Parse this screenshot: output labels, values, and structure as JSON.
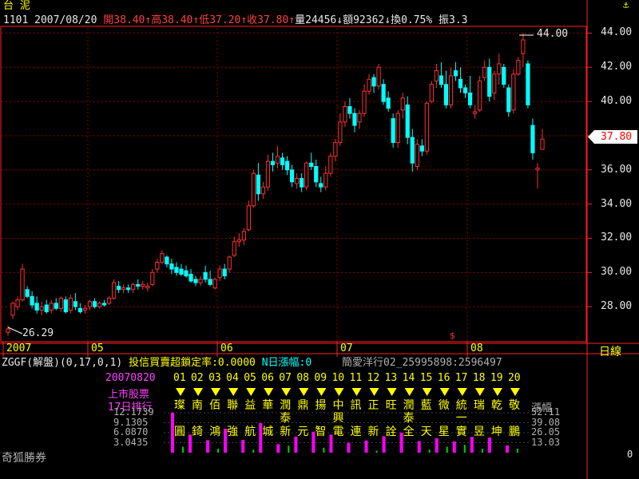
{
  "header": {
    "stock_name": "台 泥",
    "stock_code": "1101",
    "date": "2007/08/20",
    "open": "開38.40↑",
    "high": "高38.40↑",
    "low": "低37.20↑",
    "close": "收37.80↑",
    "volume": "量24456↓",
    "amount": "額92362↓",
    "turnover": "換0.75%",
    "amplitude": "振3.3"
  },
  "chart_data": {
    "type": "candlestick",
    "price_axis": {
      "ticks": [
        "44.00",
        "42.00",
        "40.00",
        "38.00",
        "36.00",
        "34.00",
        "32.00",
        "30.00",
        "28.00"
      ],
      "ylim": [
        26.0,
        44.3
      ],
      "grid": true
    },
    "x_axis": {
      "labels": [
        "2007",
        "05",
        "06",
        "07",
        "08"
      ],
      "right_label": "日線"
    },
    "annotations": {
      "high_marker": "44.00",
      "low_marker": "26.29",
      "last_price": "37.80"
    },
    "candles": [
      {
        "o": 26.5,
        "h": 26.9,
        "l": 26.3,
        "c": 26.7
      },
      {
        "o": 27.5,
        "h": 28.3,
        "l": 27.3,
        "c": 28.2
      },
      {
        "o": 28.0,
        "h": 28.6,
        "l": 27.8,
        "c": 28.4
      },
      {
        "o": 28.4,
        "h": 30.5,
        "l": 28.3,
        "c": 30.2
      },
      {
        "o": 29.0,
        "h": 29.2,
        "l": 28.5,
        "c": 28.6
      },
      {
        "o": 28.6,
        "h": 28.9,
        "l": 27.9,
        "c": 28.1
      },
      {
        "o": 28.2,
        "h": 28.6,
        "l": 27.6,
        "c": 27.8
      },
      {
        "o": 27.8,
        "h": 28.3,
        "l": 27.5,
        "c": 28.0
      },
      {
        "o": 28.1,
        "h": 28.4,
        "l": 27.6,
        "c": 27.7
      },
      {
        "o": 27.8,
        "h": 28.4,
        "l": 27.6,
        "c": 28.2
      },
      {
        "o": 28.2,
        "h": 28.5,
        "l": 27.8,
        "c": 27.9
      },
      {
        "o": 27.9,
        "h": 28.6,
        "l": 27.7,
        "c": 28.5
      },
      {
        "o": 28.4,
        "h": 28.6,
        "l": 27.6,
        "c": 27.7
      },
      {
        "o": 27.8,
        "h": 28.7,
        "l": 27.6,
        "c": 28.5
      },
      {
        "o": 28.3,
        "h": 28.8,
        "l": 27.8,
        "c": 28.0
      },
      {
        "o": 27.9,
        "h": 28.2,
        "l": 27.6,
        "c": 27.7
      },
      {
        "o": 27.8,
        "h": 28.1,
        "l": 27.6,
        "c": 27.9
      },
      {
        "o": 28.0,
        "h": 28.4,
        "l": 27.8,
        "c": 28.3
      },
      {
        "o": 28.3,
        "h": 28.5,
        "l": 27.9,
        "c": 28.0
      },
      {
        "o": 28.0,
        "h": 28.3,
        "l": 27.9,
        "c": 28.2
      },
      {
        "o": 28.2,
        "h": 28.4,
        "l": 28.0,
        "c": 28.1
      },
      {
        "o": 28.2,
        "h": 28.6,
        "l": 28.1,
        "c": 28.5
      },
      {
        "o": 28.5,
        "h": 29.6,
        "l": 28.4,
        "c": 29.4
      },
      {
        "o": 29.2,
        "h": 29.5,
        "l": 28.8,
        "c": 29.0
      },
      {
        "o": 29.0,
        "h": 29.3,
        "l": 28.8,
        "c": 29.1
      },
      {
        "o": 29.1,
        "h": 29.3,
        "l": 28.8,
        "c": 29.0
      },
      {
        "o": 29.0,
        "h": 29.4,
        "l": 28.8,
        "c": 29.3
      },
      {
        "o": 29.3,
        "h": 29.6,
        "l": 29.0,
        "c": 29.2
      },
      {
        "o": 29.2,
        "h": 29.5,
        "l": 29.0,
        "c": 29.3
      },
      {
        "o": 29.1,
        "h": 29.4,
        "l": 28.9,
        "c": 29.2
      },
      {
        "o": 29.3,
        "h": 30.2,
        "l": 29.2,
        "c": 30.0
      },
      {
        "o": 30.2,
        "h": 30.8,
        "l": 30.0,
        "c": 30.6
      },
      {
        "o": 30.6,
        "h": 31.3,
        "l": 30.5,
        "c": 31.1
      },
      {
        "o": 30.9,
        "h": 31.0,
        "l": 30.3,
        "c": 30.5
      },
      {
        "o": 30.5,
        "h": 30.8,
        "l": 29.9,
        "c": 30.2
      },
      {
        "o": 30.3,
        "h": 30.6,
        "l": 29.8,
        "c": 30.0
      },
      {
        "o": 30.2,
        "h": 30.5,
        "l": 29.8,
        "c": 29.9
      },
      {
        "o": 30.1,
        "h": 30.4,
        "l": 29.7,
        "c": 29.8
      },
      {
        "o": 29.9,
        "h": 30.2,
        "l": 29.4,
        "c": 29.5
      },
      {
        "o": 29.6,
        "h": 29.8,
        "l": 29.2,
        "c": 29.4
      },
      {
        "o": 29.4,
        "h": 29.8,
        "l": 29.2,
        "c": 29.6
      },
      {
        "o": 30.0,
        "h": 30.4,
        "l": 29.4,
        "c": 29.6
      },
      {
        "o": 29.6,
        "h": 30.1,
        "l": 29.2,
        "c": 29.3
      },
      {
        "o": 29.1,
        "h": 29.7,
        "l": 29.0,
        "c": 29.6
      },
      {
        "o": 29.7,
        "h": 30.4,
        "l": 29.5,
        "c": 30.2
      },
      {
        "o": 30.2,
        "h": 30.5,
        "l": 29.6,
        "c": 29.8
      },
      {
        "o": 30.2,
        "h": 31.0,
        "l": 30.0,
        "c": 30.9
      },
      {
        "o": 31.0,
        "h": 32.1,
        "l": 30.9,
        "c": 31.8
      },
      {
        "o": 31.8,
        "h": 32.3,
        "l": 31.5,
        "c": 31.9
      },
      {
        "o": 31.9,
        "h": 32.6,
        "l": 31.6,
        "c": 32.4
      },
      {
        "o": 32.5,
        "h": 34.2,
        "l": 32.4,
        "c": 33.9
      },
      {
        "o": 33.9,
        "h": 36.0,
        "l": 33.8,
        "c": 35.8
      },
      {
        "o": 35.7,
        "h": 36.4,
        "l": 34.2,
        "c": 34.6
      },
      {
        "o": 34.6,
        "h": 35.3,
        "l": 34.3,
        "c": 35.0
      },
      {
        "o": 35.0,
        "h": 36.9,
        "l": 34.8,
        "c": 36.5
      },
      {
        "o": 36.5,
        "h": 37.0,
        "l": 35.9,
        "c": 36.3
      },
      {
        "o": 36.4,
        "h": 37.4,
        "l": 36.1,
        "c": 36.8
      },
      {
        "o": 36.7,
        "h": 37.0,
        "l": 36.0,
        "c": 36.3
      },
      {
        "o": 36.5,
        "h": 36.8,
        "l": 35.7,
        "c": 36.0
      },
      {
        "o": 36.0,
        "h": 36.3,
        "l": 35.0,
        "c": 35.3
      },
      {
        "o": 35.2,
        "h": 35.8,
        "l": 34.9,
        "c": 35.5
      },
      {
        "o": 35.5,
        "h": 35.8,
        "l": 34.7,
        "c": 35.0
      },
      {
        "o": 35.0,
        "h": 36.5,
        "l": 34.8,
        "c": 36.4
      },
      {
        "o": 36.4,
        "h": 37.0,
        "l": 36.0,
        "c": 36.2
      },
      {
        "o": 36.2,
        "h": 36.6,
        "l": 35.0,
        "c": 35.3
      },
      {
        "o": 35.2,
        "h": 35.6,
        "l": 34.7,
        "c": 35.0
      },
      {
        "o": 35.0,
        "h": 36.2,
        "l": 34.8,
        "c": 35.8
      },
      {
        "o": 35.8,
        "h": 37.0,
        "l": 35.6,
        "c": 36.8
      },
      {
        "o": 36.8,
        "h": 37.8,
        "l": 36.5,
        "c": 37.6
      },
      {
        "o": 37.6,
        "h": 39.3,
        "l": 37.4,
        "c": 38.8
      },
      {
        "o": 38.8,
        "h": 40.0,
        "l": 38.5,
        "c": 39.7
      },
      {
        "o": 39.7,
        "h": 40.2,
        "l": 39.0,
        "c": 39.3
      },
      {
        "o": 39.3,
        "h": 39.6,
        "l": 38.2,
        "c": 38.6
      },
      {
        "o": 38.8,
        "h": 39.5,
        "l": 38.4,
        "c": 39.3
      },
      {
        "o": 39.3,
        "h": 41.0,
        "l": 39.1,
        "c": 40.6
      },
      {
        "o": 40.6,
        "h": 41.6,
        "l": 40.4,
        "c": 41.3
      },
      {
        "o": 41.4,
        "h": 41.6,
        "l": 40.5,
        "c": 40.9
      },
      {
        "o": 40.9,
        "h": 42.2,
        "l": 40.7,
        "c": 42.0
      },
      {
        "o": 41.0,
        "h": 41.3,
        "l": 39.8,
        "c": 40.0
      },
      {
        "o": 40.2,
        "h": 40.6,
        "l": 39.4,
        "c": 39.6
      },
      {
        "o": 39.0,
        "h": 39.3,
        "l": 37.3,
        "c": 37.6
      },
      {
        "o": 37.6,
        "h": 39.5,
        "l": 37.3,
        "c": 39.3
      },
      {
        "o": 39.5,
        "h": 40.5,
        "l": 39.0,
        "c": 40.2
      },
      {
        "o": 39.8,
        "h": 40.3,
        "l": 37.5,
        "c": 37.9
      },
      {
        "o": 37.9,
        "h": 38.4,
        "l": 35.9,
        "c": 36.4
      },
      {
        "o": 36.2,
        "h": 37.8,
        "l": 36.0,
        "c": 37.5
      },
      {
        "o": 37.4,
        "h": 37.8,
        "l": 36.8,
        "c": 37.1
      },
      {
        "o": 37.1,
        "h": 40.0,
        "l": 36.9,
        "c": 39.9
      },
      {
        "o": 40.0,
        "h": 41.2,
        "l": 39.9,
        "c": 41.0
      },
      {
        "o": 41.2,
        "h": 42.2,
        "l": 40.8,
        "c": 41.8
      },
      {
        "o": 41.5,
        "h": 42.3,
        "l": 40.8,
        "c": 41.0
      },
      {
        "o": 41.0,
        "h": 41.8,
        "l": 39.6,
        "c": 39.8
      },
      {
        "o": 39.8,
        "h": 42.0,
        "l": 39.6,
        "c": 41.5
      },
      {
        "o": 41.8,
        "h": 42.3,
        "l": 41.2,
        "c": 41.5
      },
      {
        "o": 41.3,
        "h": 42.0,
        "l": 40.5,
        "c": 40.8
      },
      {
        "o": 40.8,
        "h": 41.0,
        "l": 40.2,
        "c": 40.5
      },
      {
        "o": 40.5,
        "h": 41.5,
        "l": 39.6,
        "c": 39.8
      },
      {
        "o": 39.3,
        "h": 39.8,
        "l": 39.0,
        "c": 39.4
      },
      {
        "o": 39.5,
        "h": 41.5,
        "l": 39.4,
        "c": 41.2
      },
      {
        "o": 41.4,
        "h": 42.4,
        "l": 41.2,
        "c": 42.0
      },
      {
        "o": 42.0,
        "h": 42.5,
        "l": 40.0,
        "c": 40.3
      },
      {
        "o": 40.5,
        "h": 41.8,
        "l": 40.1,
        "c": 41.6
      },
      {
        "o": 41.6,
        "h": 42.8,
        "l": 41.0,
        "c": 42.2
      },
      {
        "o": 42.0,
        "h": 42.2,
        "l": 40.8,
        "c": 41.0
      },
      {
        "o": 40.8,
        "h": 41.0,
        "l": 39.1,
        "c": 39.4
      },
      {
        "o": 39.5,
        "h": 41.9,
        "l": 39.3,
        "c": 41.6
      },
      {
        "o": 41.6,
        "h": 42.6,
        "l": 41.5,
        "c": 42.4
      },
      {
        "o": 42.8,
        "h": 44.0,
        "l": 42.0,
        "c": 43.6
      },
      {
        "o": 42.2,
        "h": 42.4,
        "l": 39.6,
        "c": 39.8
      },
      {
        "o": 38.6,
        "h": 39.0,
        "l": 36.6,
        "c": 37.0
      },
      {
        "o": 36.0,
        "h": 36.4,
        "l": 34.9,
        "c": 36.1
      },
      {
        "o": 37.2,
        "h": 38.4,
        "l": 37.2,
        "c": 37.8
      }
    ]
  },
  "indicator": {
    "label": "ZGGF(解盤)(0,17,0,1)",
    "desc": "投信買賣超鎖定率:0.0000",
    "n_day": "N日漲幅:0",
    "info": "簡愛洋行02_25995898:2596497",
    "date": "20070820",
    "market": "上市股票",
    "rank": "17日排行",
    "ranks": [
      "01",
      "02",
      "03",
      "04",
      "05",
      "06",
      "07",
      "08",
      "09",
      "10",
      "11",
      "12",
      "13",
      "14",
      "15",
      "16",
      "17",
      "18",
      "19",
      "20"
    ],
    "names_top": [
      "璨",
      "南",
      "佰",
      "聯",
      "益",
      "華",
      "潤",
      "鼎",
      "揚",
      "中",
      "訊",
      "正",
      "旺",
      "潤",
      "藍",
      "微",
      "統",
      "瑞",
      "乾",
      "敬"
    ],
    "names_mid": [
      "",
      "",
      "",
      "",
      "",
      "",
      "泰",
      "",
      "",
      "興",
      "",
      "",
      "",
      "泰",
      "",
      "",
      "一",
      "",
      "",
      ""
    ],
    "names_bot": [
      "圓",
      "錡",
      "鴻",
      "強",
      "航",
      "城",
      "新",
      "元",
      "智",
      "電",
      "連",
      "新",
      "詮",
      "全",
      "天",
      "星",
      "實",
      "昱",
      "坤",
      "鵬"
    ],
    "left_scale": [
      "12.1739",
      "9.1305",
      "6.0870",
      "3.0435"
    ],
    "right_title": "漲幅",
    "right_scale": [
      "52.11",
      "39.08",
      "26.05",
      "13.03"
    ],
    "zero": "0",
    "bars": [
      {
        "m": 12.2,
        "g": 0.6
      },
      {
        "m": 5.5,
        "g": 0.0
      },
      {
        "m": 3.8,
        "g": 0.4
      },
      {
        "m": 7.3,
        "g": 0.0
      },
      {
        "m": 3.9,
        "g": 0.3
      },
      {
        "m": 9.0,
        "g": 0.0
      },
      {
        "m": 2.6,
        "g": 0.7
      },
      {
        "m": 4.9,
        "g": 0.0
      },
      {
        "m": 6.4,
        "g": 0.5
      },
      {
        "m": 5.5,
        "g": 0.0
      },
      {
        "m": 3.0,
        "g": 0.0
      },
      {
        "m": 3.7,
        "g": 0.2
      },
      {
        "m": 5.0,
        "g": 0.0
      },
      {
        "m": 6.1,
        "g": 0.0
      },
      {
        "m": 3.5,
        "g": 0.3
      },
      {
        "m": 4.4,
        "g": 0.6
      },
      {
        "m": 3.4,
        "g": 0.8
      },
      {
        "m": 4.8,
        "g": 0.4
      },
      {
        "m": 4.6,
        "g": 0.0
      },
      {
        "m": 2.2,
        "g": 0.4
      }
    ]
  },
  "footer": {
    "watermark": "奇狐勝券"
  },
  "colors": {
    "up": "#ff3030",
    "down": "#00ffff",
    "grid": "#8b0000",
    "axis": "#ff2020"
  }
}
